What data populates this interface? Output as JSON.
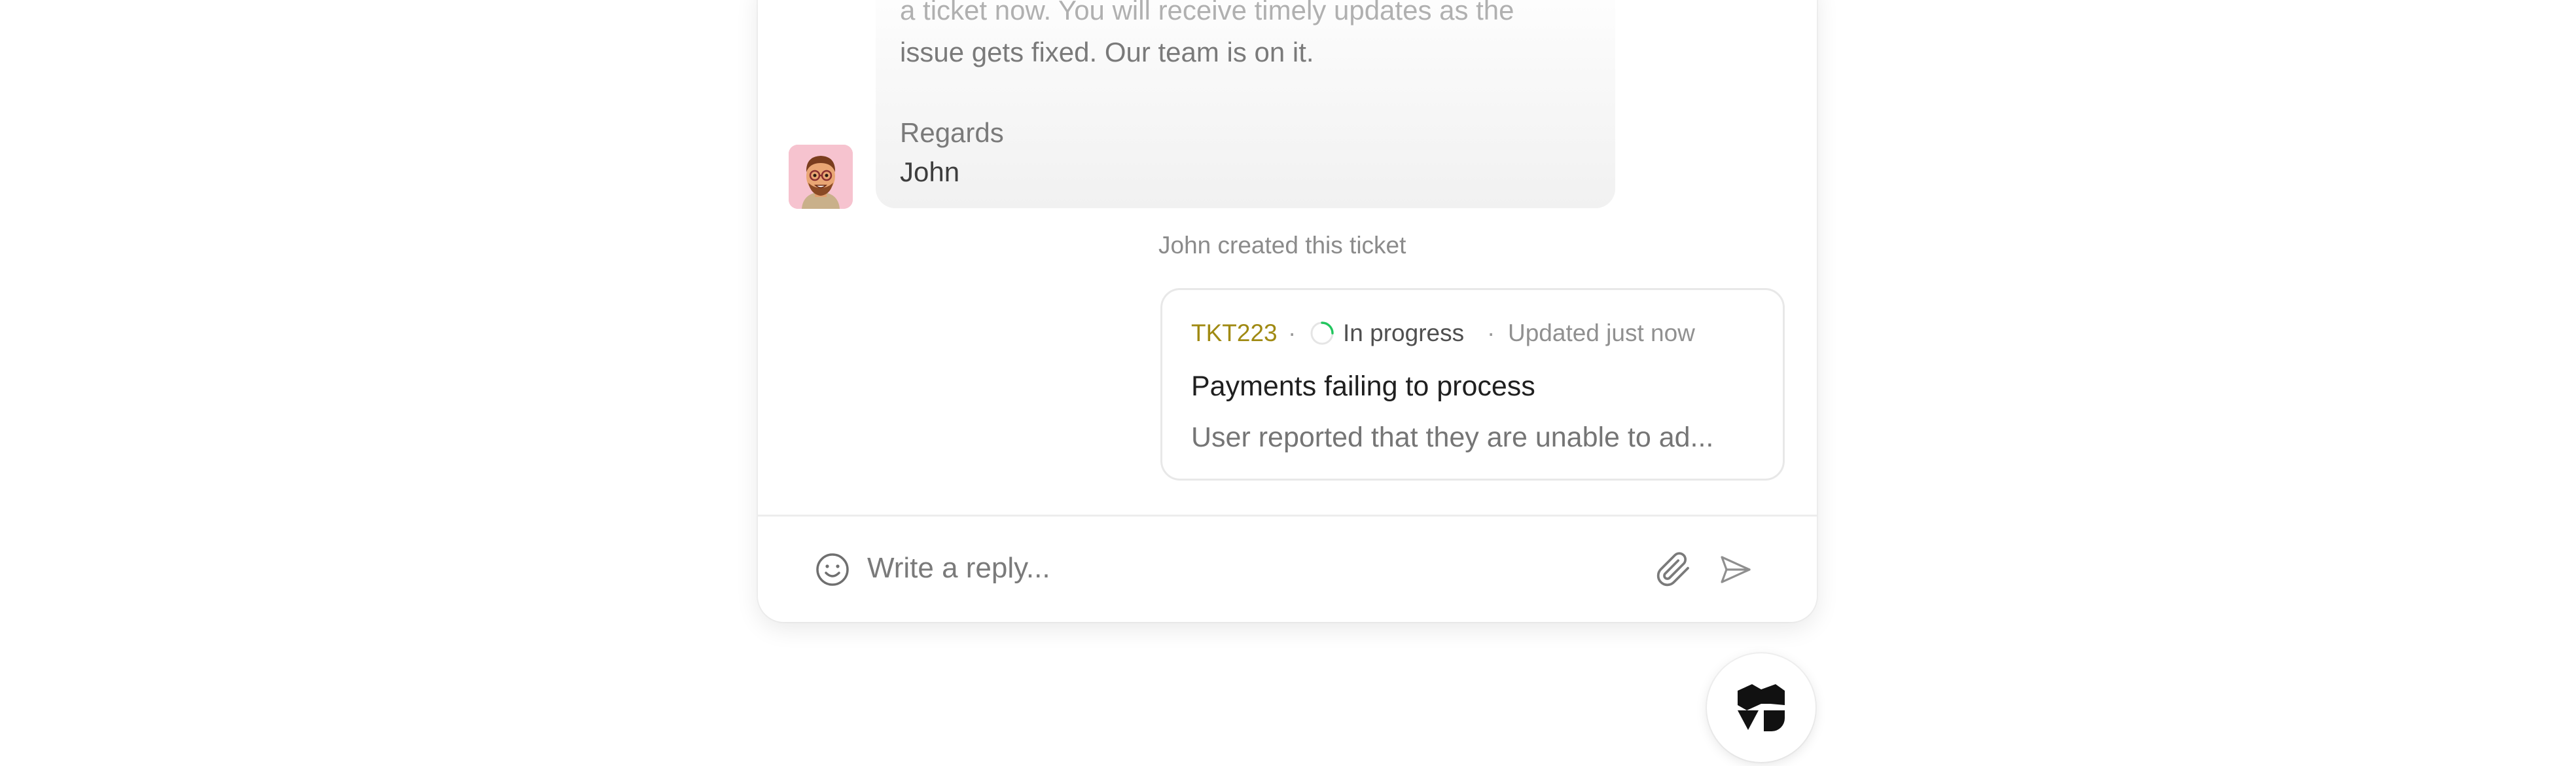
{
  "message": {
    "lines": [
      "a ticket now. You will receive timely updates as the",
      "issue gets fixed. Our team is on it."
    ],
    "closing": "Regards",
    "signature": "John",
    "avatar_icon": "memoji-avatar"
  },
  "event_text": "John created this ticket",
  "ticket": {
    "id": "TKT223",
    "separator": "·",
    "status": "In progress",
    "status_icon": "progress-spinner-icon",
    "status_color": "#22c55e",
    "updated": "Updated just now",
    "title": "Payments failing to process",
    "description": "User reported that they are unable to ad..."
  },
  "composer": {
    "placeholder": "Write a reply...",
    "emoji_icon": "smiley-icon",
    "attach_icon": "paperclip-icon",
    "send_icon": "send-icon"
  },
  "launcher": {
    "icon": "brand-logo-icon"
  },
  "colors": {
    "ticket_id": "#a08a13",
    "accent_progress": "#22c55e"
  }
}
